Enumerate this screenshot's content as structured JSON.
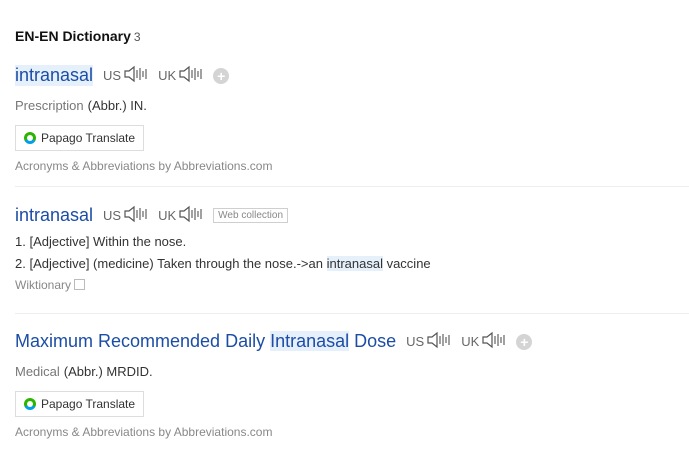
{
  "section": {
    "title": "EN-EN Dictionary",
    "count": "3"
  },
  "entries": [
    {
      "word": "intranasal",
      "us_label": "US",
      "uk_label": "UK",
      "category": "Prescription",
      "abbr": "(Abbr.) IN.",
      "translate_label": "Papago Translate",
      "source": "Acronyms & Abbreviations by Abbreviations.com"
    },
    {
      "word": "intranasal",
      "us_label": "US",
      "uk_label": "UK",
      "tag": "Web collection",
      "definitions": [
        {
          "pre": "1. [Adjective] Within the nose.",
          "hl": "",
          "post": ""
        },
        {
          "pre": "2. [Adjective] (medicine) Taken through the nose.->an ",
          "hl": "intranasal",
          "post": " vaccine"
        }
      ],
      "source": "Wiktionary"
    },
    {
      "word_pre": "Maximum Recommended Daily ",
      "word_hl": "Intranasal",
      "word_post": " Dose",
      "us_label": "US",
      "uk_label": "UK",
      "category": "Medical",
      "abbr": "(Abbr.) MRDID.",
      "translate_label": "Papago Translate",
      "source": "Acronyms & Abbreviations by Abbreviations.com"
    }
  ],
  "icons": {
    "speaker": "speaker-icon",
    "plus": "add-icon",
    "copy": "copy-icon",
    "papago": "papago-icon"
  }
}
